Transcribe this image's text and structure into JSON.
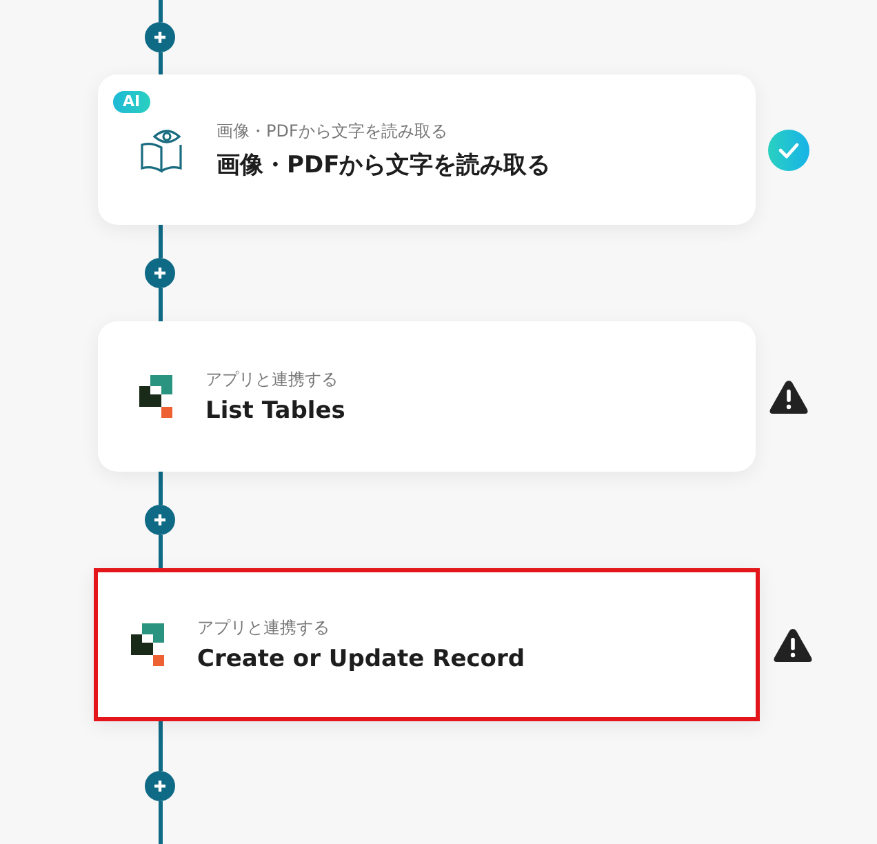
{
  "steps": [
    {
      "badge": "AI",
      "kind": "ocr",
      "caption": "画像・PDFから文字を読み取る",
      "title": "画像・PDFから文字を読み取る",
      "done": true,
      "selected": false
    },
    {
      "kind": "app",
      "caption": "アプリと連携する",
      "title": "List Tables",
      "done": false,
      "selected": false
    },
    {
      "kind": "app",
      "caption": "アプリと連携する",
      "title": "Create or Update Record",
      "done": false,
      "selected": true
    }
  ]
}
